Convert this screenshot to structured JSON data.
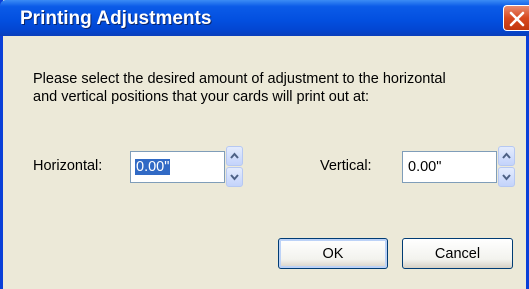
{
  "dialog": {
    "title": "Printing Adjustments",
    "close_icon": "close-icon",
    "instructions_line1": "Please select the desired amount of adjustment to the horizontal",
    "instructions_line2": "and vertical positions that your cards will print out at:"
  },
  "horizontal": {
    "label": "Horizontal:",
    "value": "0.00\""
  },
  "vertical": {
    "label": "Vertical:",
    "value": "0.00\""
  },
  "buttons": {
    "ok": "OK",
    "cancel": "Cancel"
  },
  "icons": {
    "spin_up": "chevron-up-icon",
    "spin_down": "chevron-down-icon"
  },
  "colors": {
    "titlebar": "#0350e0",
    "close_button": "#d8491f",
    "dialog_background": "#ece9d8",
    "selection": "#316ac5"
  }
}
